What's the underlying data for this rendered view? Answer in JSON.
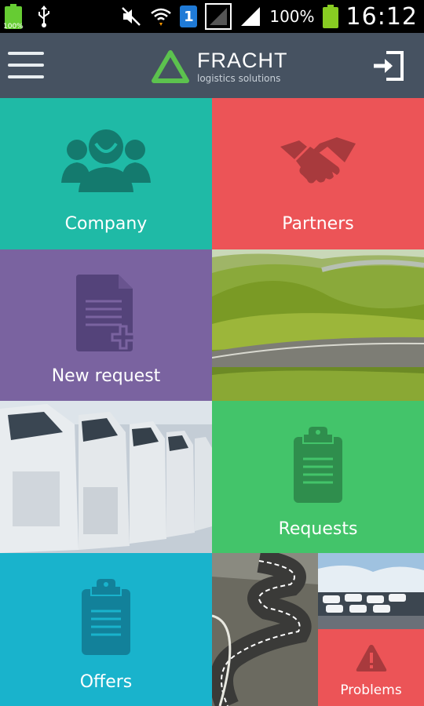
{
  "status_bar": {
    "battery_small_label": "100%",
    "sim_number": "1",
    "battery_percent": "100%",
    "time": "16:12"
  },
  "app_header": {
    "brand_name": "FRACHT",
    "brand_tagline": "logistics solutions",
    "menu_icon": "hamburger-menu-icon",
    "login_icon": "sign-in-icon"
  },
  "tiles": {
    "company": {
      "label": "Company",
      "icon": "group-icon",
      "color": "#1fbaa6"
    },
    "partners": {
      "label": "Partners",
      "icon": "handshake-icon",
      "color": "#ec5457"
    },
    "new_request": {
      "label": "New request",
      "icon": "add-document-icon",
      "color": "#7a63a0"
    },
    "requests": {
      "label": "Requests",
      "icon": "clipboard-icon",
      "color": "#43c46a"
    },
    "offers": {
      "label": "Offers",
      "icon": "clipboard-icon",
      "color": "#19b3cc"
    },
    "problems": {
      "label": "Problems",
      "icon": "warning-icon",
      "color": "#ec5457"
    }
  },
  "colors": {
    "header_bg": "#465261",
    "logo_green": "#5cc24e"
  }
}
